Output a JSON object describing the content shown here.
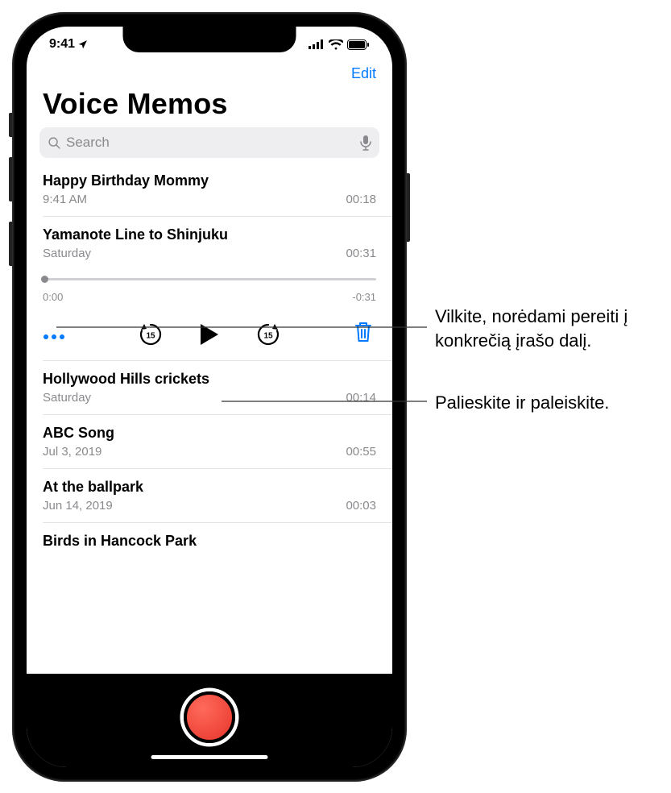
{
  "status": {
    "time": "9:41",
    "location_arrow": "➤"
  },
  "header": {
    "edit": "Edit",
    "title": "Voice Memos"
  },
  "search": {
    "placeholder": "Search"
  },
  "memos": [
    {
      "title": "Happy Birthday Mommy",
      "date": "9:41 AM",
      "duration": "00:18"
    },
    {
      "title": "Yamanote Line to Shinjuku",
      "date": "Saturday",
      "duration": "00:31"
    },
    {
      "title": "Hollywood Hills crickets",
      "date": "Saturday",
      "duration": "00:14"
    },
    {
      "title": "ABC Song",
      "date": "Jul 3, 2019",
      "duration": "00:55"
    },
    {
      "title": "At the ballpark",
      "date": "Jun 14, 2019",
      "duration": "00:03"
    },
    {
      "title": "Birds in Hancock Park",
      "date": "",
      "duration": ""
    }
  ],
  "playback": {
    "elapsed": "0:00",
    "remaining": "-0:31"
  },
  "callouts": {
    "scrub": "Vilkite, norėdami pereiti į konkrečią įrašo dalį.",
    "play": "Palieskite ir paleiskite."
  },
  "colors": {
    "accent": "#007aff",
    "record": "#e7352b"
  }
}
